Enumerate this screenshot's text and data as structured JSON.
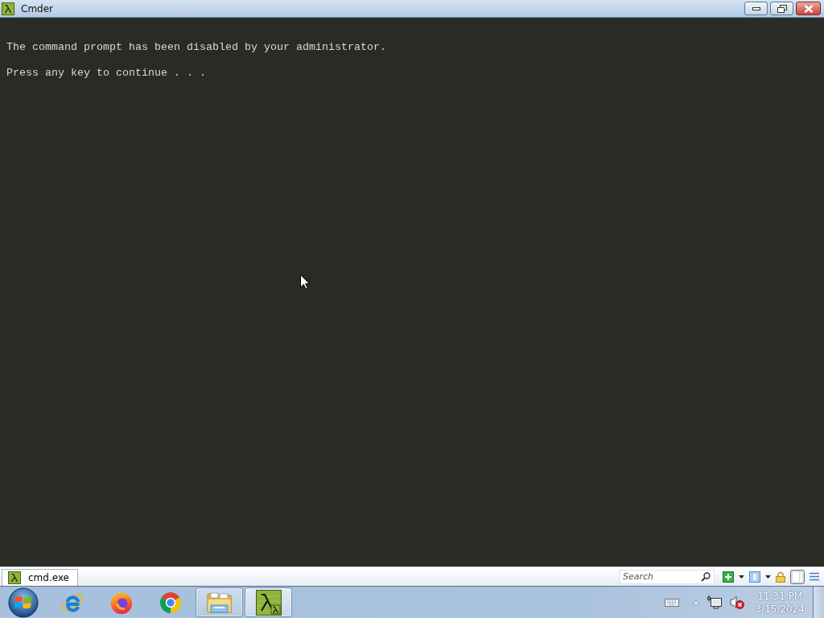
{
  "window": {
    "title": "Cmder"
  },
  "console": {
    "lines": [
      "The command prompt has been disabled by your administrator.",
      "Press any key to continue . . ."
    ]
  },
  "tabs": [
    {
      "label": "cmd.exe",
      "selected": true
    }
  ],
  "toolbar": {
    "search": {
      "placeholder": "Search"
    }
  },
  "taskbar": {
    "apps": [
      {
        "kind": "ie",
        "running": false,
        "active": false
      },
      {
        "kind": "firefox",
        "running": false,
        "active": false
      },
      {
        "kind": "chrome",
        "running": false,
        "active": false
      },
      {
        "kind": "explorer",
        "running": true,
        "active": false
      },
      {
        "kind": "cmder",
        "running": true,
        "active": true
      }
    ],
    "tray": {
      "muted": true
    },
    "clock": {
      "time": "11:31 PM",
      "date": "3/15/2024"
    }
  }
}
